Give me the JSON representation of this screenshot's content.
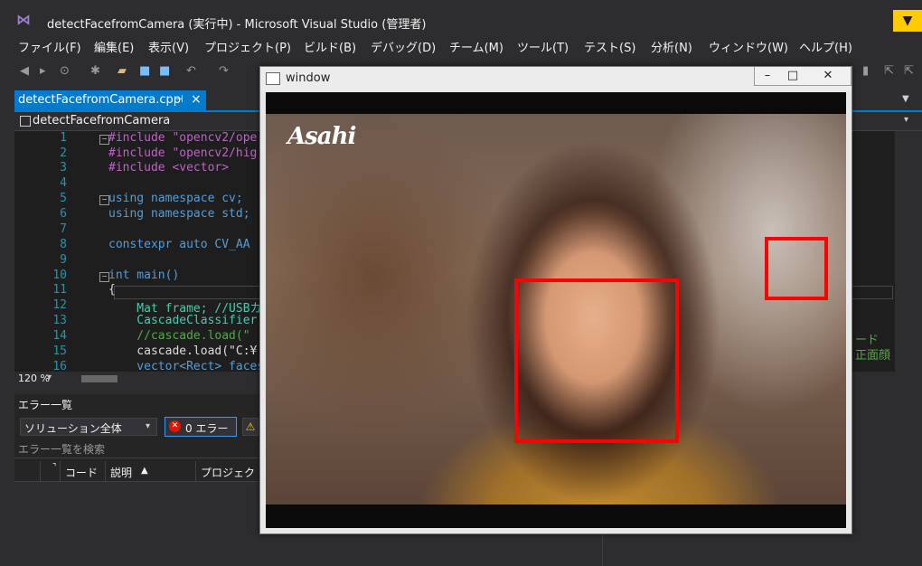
{
  "window": {
    "title": "detectFacefromCamera (実行中) - Microsoft Visual Studio  (管理者)"
  },
  "menu": [
    "ファイル(F)",
    "編集(E)",
    "表示(V)",
    "プロジェクト(P)",
    "ビルド(B)",
    "デバッグ(D)",
    "チーム(M)",
    "ツール(T)",
    "テスト(S)",
    "分析(N)",
    "ウィンドウ(W)",
    "ヘルプ(H)"
  ],
  "editor": {
    "tab_label": "detectFacefromCamera.cpp",
    "nav_label": "detectFacefromCamera",
    "zoom": "120 %",
    "line_numbers": [
      "1",
      "2",
      "3",
      "4",
      "5",
      "6",
      "7",
      "8",
      "9",
      "10",
      "11",
      "12",
      "13",
      "14",
      "15",
      "16"
    ],
    "lines": [
      "#include \"opencv2/ope",
      "#include \"opencv2/hig",
      "#include <vector>",
      "",
      "using namespace cv;",
      "using namespace std;",
      "",
      "constexpr auto CV_AA",
      "",
      "int main()",
      "{",
      "    Mat frame; //USBカ",
      "    CascadeClassifier",
      "    //cascade.load(\"",
      "    cascade.load(\"C:¥",
      "    vector<Rect> faces"
    ],
    "side_comment_1": "ード",
    "side_comment_2": "正面顔"
  },
  "error_list": {
    "title": "エラー一覧",
    "scope": "ソリューション全体",
    "error_count": "0 エラー",
    "search_placeholder": "エラー一覧を検索",
    "columns": [
      "コード",
      "説明",
      "プロジェク"
    ]
  },
  "cv_window": {
    "title": "window",
    "brand": "Asahi",
    "buttons": [
      "–",
      "□",
      "✕"
    ]
  }
}
